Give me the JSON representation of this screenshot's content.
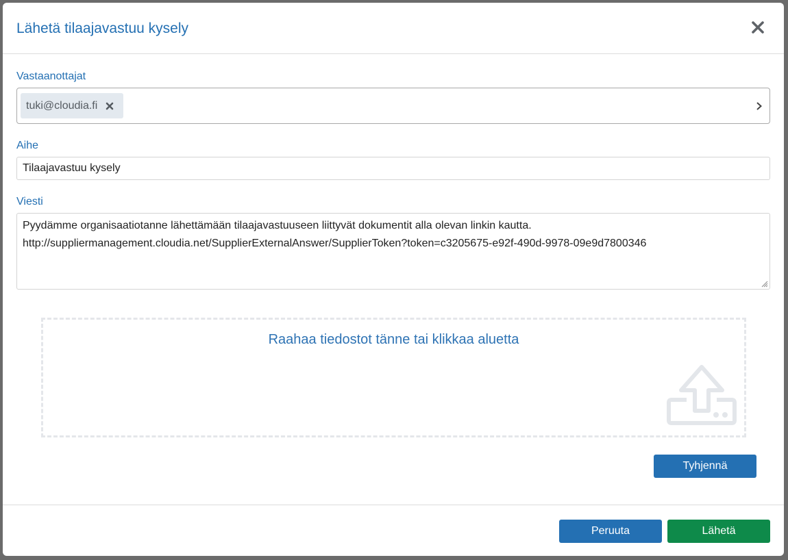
{
  "dialog": {
    "title": "Lähetä tilaajavastuu kysely"
  },
  "recipients": {
    "label": "Vastaanottajat",
    "chips": [
      {
        "label": "tuki@cloudia.fi"
      }
    ]
  },
  "subject": {
    "label": "Aihe",
    "value": "Tilaajavastuu kysely"
  },
  "message": {
    "label": "Viesti",
    "lines": [
      "Pyydämme organisaatiotanne lähettämään tilaajavastuuseen liittyvät dokumentit alla olevan linkin kautta.",
      "http://suppliermanagement.cloudia.net/SupplierExternalAnswer/SupplierToken?token=c3205675-e92f-490d-9978-09e9d7800346"
    ]
  },
  "dropzone": {
    "text": "Raahaa tiedostot tänne tai klikkaa aluetta",
    "icon": "upload-icon"
  },
  "buttons": {
    "clear": "Tyhjennä",
    "cancel": "Peruuta",
    "send": "Lähetä"
  },
  "colors": {
    "accent": "#2470b3",
    "success": "#0e8a4a",
    "chip_bg": "#e3e9ef"
  }
}
